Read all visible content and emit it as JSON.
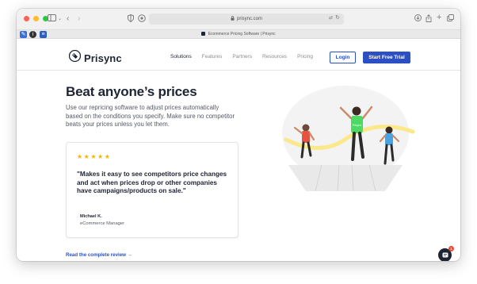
{
  "browser": {
    "url": "prisync.com",
    "tab_title": "Ecommerce Pricing Software | Prisync"
  },
  "header": {
    "logo_text": "Prisync",
    "nav": [
      "Solutions",
      "Features",
      "Partners",
      "Resources",
      "Pricing"
    ],
    "login_label": "Login",
    "trial_label": "Start Free Trial"
  },
  "hero": {
    "title": "Beat anyone’s prices",
    "description": "Use our repricing software to adjust prices automatically based on the conditions you specify. Make sure no competitor beats your prices unless you let them."
  },
  "review": {
    "stars": "★★★★★",
    "quote": "\"Makes it easy to see competitors price changes and act when prices drop or other companies have campaigns/products on sale.\"",
    "author": "Michael K.",
    "role": "eCommerce Manager",
    "link": "Read the complete review →"
  },
  "illustration": {
    "jersey_text": "Prisync"
  },
  "chat": {
    "badge": "1"
  },
  "colors": {
    "brand_blue": "#2c4fc4",
    "dark": "#1d2433",
    "star": "#f5b400",
    "runner_green": "#4cd964",
    "finish_tape": "#fbe88a"
  }
}
